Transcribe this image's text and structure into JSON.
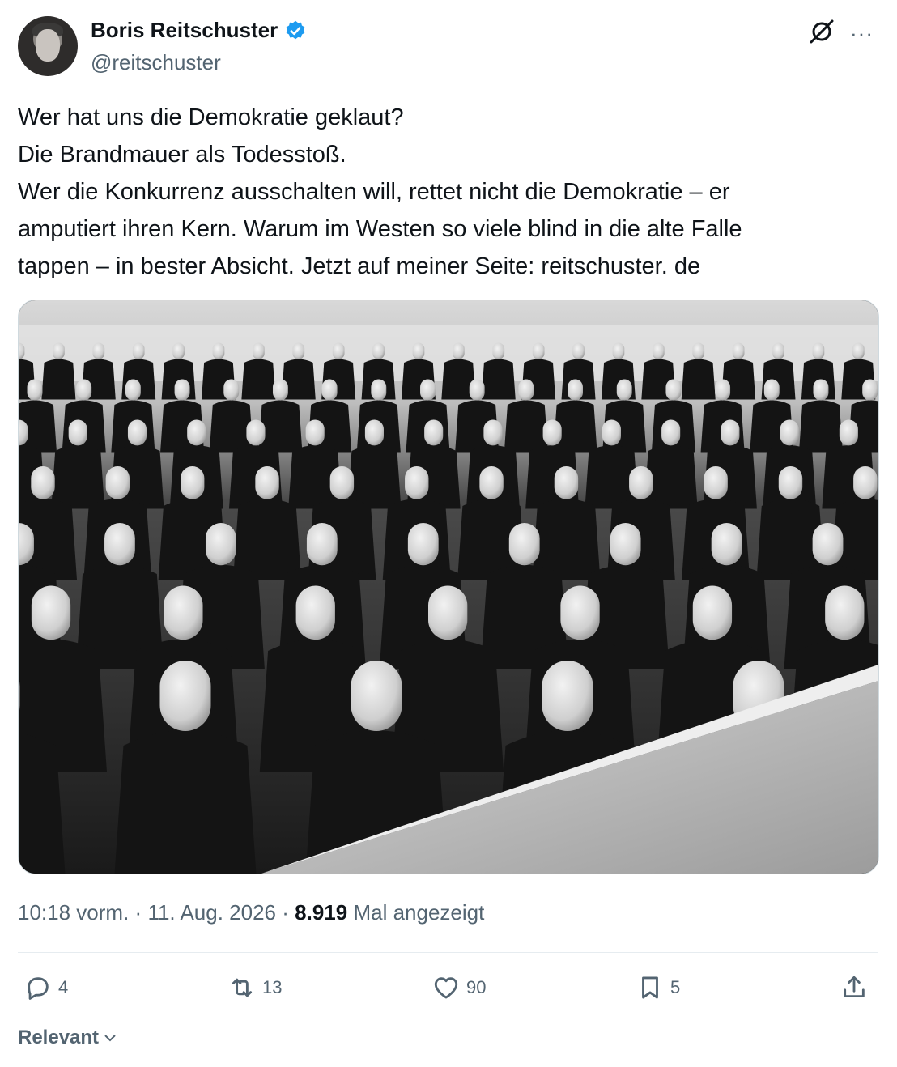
{
  "author": {
    "name": "Boris Reitschuster",
    "handle": "@reitschuster"
  },
  "tweet": {
    "lines": [
      "Wer hat uns die Demokratie geklaut?",
      "Die Brandmauer als Todesstoß.",
      "Wer die Konkurrenz ausschalten will, rettet nicht die Demokratie – er",
      "amputiert ihren Kern. Warum im Westen so viele blind in die alte Falle",
      "tappen – in bester Absicht. Jetzt auf meiner Seite: reitschuster. de"
    ]
  },
  "meta": {
    "time": "10:18 vorm.",
    "sep1": "·",
    "date": "11. Aug. 2026",
    "sep2": "·",
    "views": "8.919",
    "views_label": "Mal angezeigt"
  },
  "actions": {
    "replies": "4",
    "reposts": "13",
    "likes": "90",
    "bookmarks": "5"
  },
  "sort": {
    "label": "Relevant"
  },
  "icons": {
    "more": "more-icon",
    "grok": "grok-icon",
    "verified": "verified-badge-icon",
    "reply": "reply-icon",
    "repost": "repost-icon",
    "like": "heart-icon",
    "bookmark": "bookmark-icon",
    "share": "share-icon",
    "chevron": "chevron-down-icon"
  },
  "colors": {
    "text": "#0f1419",
    "secondary": "#536471",
    "verified": "#1d9bf0"
  }
}
